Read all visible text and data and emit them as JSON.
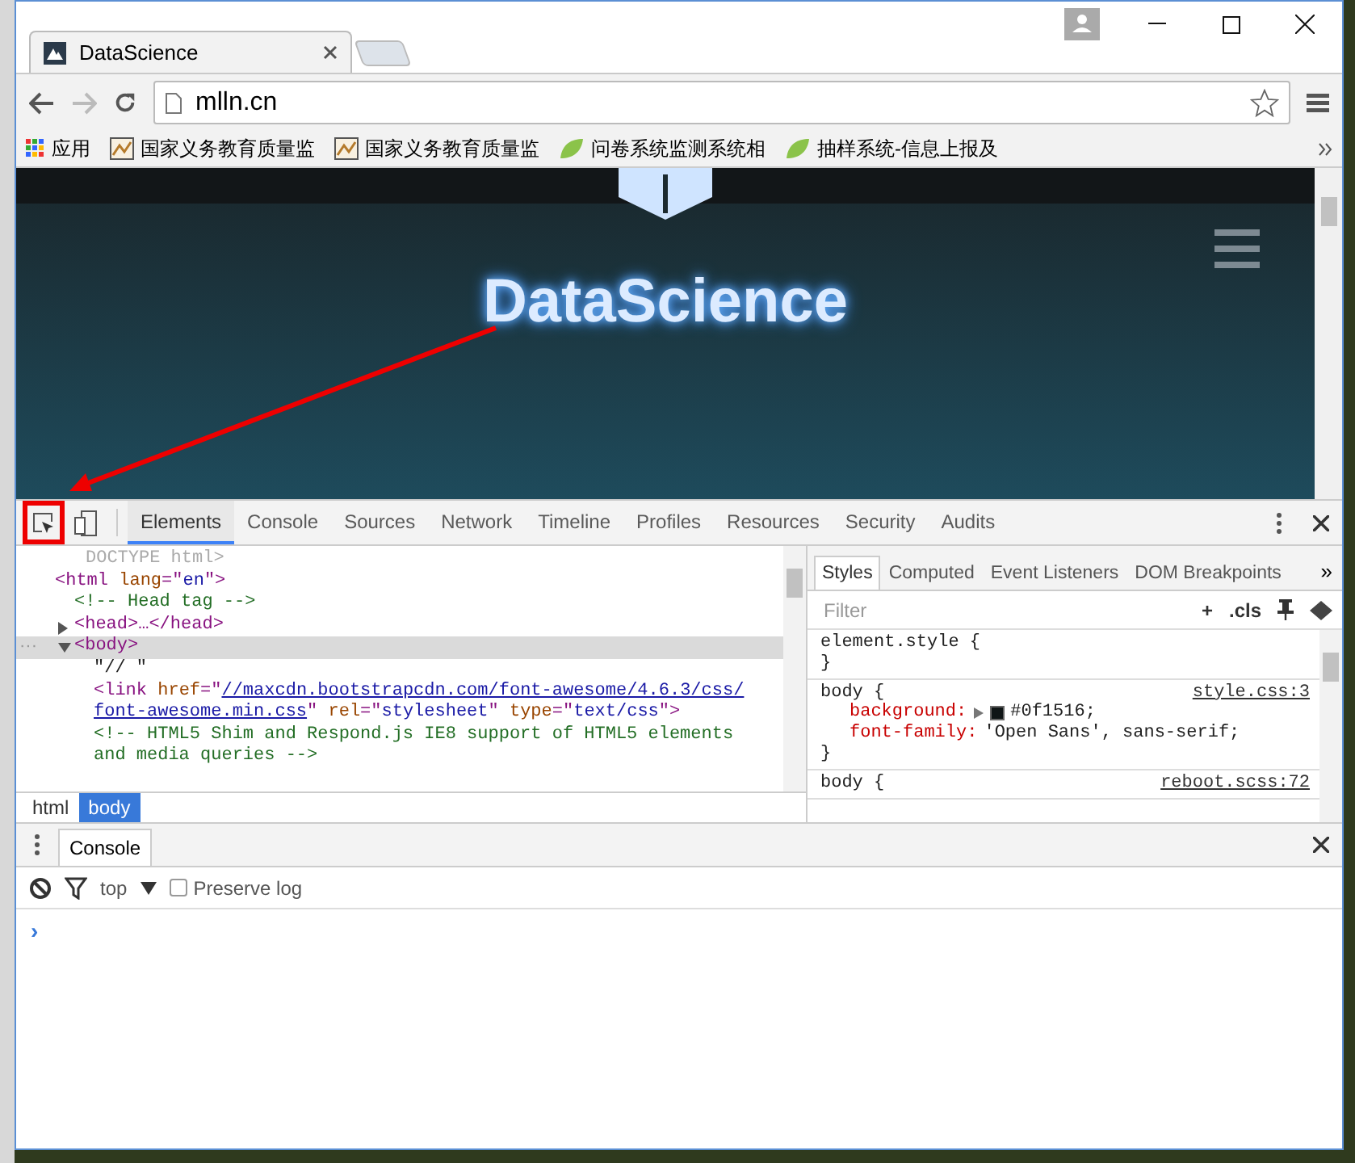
{
  "browser": {
    "tab": {
      "title": "DataScience"
    },
    "address": "mlln.cn",
    "bookmarks": [
      {
        "label": "应用",
        "kind": "apps"
      },
      {
        "label": "国家义务教育质量监",
        "kind": "page"
      },
      {
        "label": "国家义务教育质量监",
        "kind": "page"
      },
      {
        "label": "问卷系统监测系统相",
        "kind": "leaf"
      },
      {
        "label": "抽样系统-信息上报及",
        "kind": "leaf"
      }
    ]
  },
  "page": {
    "brand": "DataScience"
  },
  "devtools": {
    "inspect_highlighted": true,
    "tabs": [
      {
        "label": "Elements",
        "selected": true
      },
      {
        "label": "Console",
        "selected": false
      },
      {
        "label": "Sources",
        "selected": false
      },
      {
        "label": "Network",
        "selected": false
      },
      {
        "label": "Timeline",
        "selected": false
      },
      {
        "label": "Profiles",
        "selected": false
      },
      {
        "label": "Resources",
        "selected": false
      },
      {
        "label": "Security",
        "selected": false
      },
      {
        "label": "Audits",
        "selected": false
      }
    ],
    "selection_marker": "···",
    "dom": [
      {
        "selected": false,
        "lines": [
          [
            {
              "kind": "grey",
              "text": "DOCTYPE html>"
            }
          ]
        ]
      },
      {
        "selected": false,
        "lines": [
          [
            {
              "kind": "tag",
              "text": "<html"
            },
            {
              "kind": "attr",
              "text": " lang"
            },
            {
              "kind": "tag",
              "text": "=\""
            },
            {
              "kind": "value",
              "text": "en"
            },
            {
              "kind": "tag",
              "text": "\">"
            }
          ]
        ],
        "children": [
          {
            "selected": false,
            "lines": [
              [
                {
                  "kind": "comment",
                  "text": "<!-- Head tag -->"
                }
              ]
            ]
          },
          {
            "selected": false,
            "expanded": false,
            "lines": [
              [
                {
                  "kind": "tag",
                  "text": "<head>…</head>"
                }
              ]
            ]
          },
          {
            "selected": true,
            "expanded": true,
            "lines": [
              [
                {
                  "kind": "tag",
                  "text": "<body>"
                }
              ]
            ],
            "children": [
              {
                "selected": false,
                "lines": [
                  [
                    {
                      "kind": "text",
                      "text": "\"// \""
                    }
                  ]
                ]
              },
              {
                "selected": false,
                "lines": [
                  [
                    {
                      "kind": "tag",
                      "text": "<link"
                    },
                    {
                      "kind": "attr",
                      "text": " href"
                    },
                    {
                      "kind": "tag",
                      "text": "=\""
                    },
                    {
                      "kind": "link",
                      "text": "//maxcdn.bootstrapcdn.com/font-awesome/4.6.3/css/"
                    }
                  ],
                  [
                    {
                      "kind": "link",
                      "text": "font-awesome.min.css"
                    },
                    {
                      "kind": "tag",
                      "text": "\""
                    },
                    {
                      "kind": "attr",
                      "text": " rel"
                    },
                    {
                      "kind": "tag",
                      "text": "=\""
                    },
                    {
                      "kind": "value",
                      "text": "stylesheet"
                    },
                    {
                      "kind": "tag",
                      "text": "\""
                    },
                    {
                      "kind": "attr",
                      "text": " type"
                    },
                    {
                      "kind": "tag",
                      "text": "=\""
                    },
                    {
                      "kind": "value",
                      "text": "text/css"
                    },
                    {
                      "kind": "tag",
                      "text": "\">"
                    }
                  ]
                ]
              },
              {
                "selected": false,
                "lines": [
                  [
                    {
                      "kind": "comment",
                      "text": "<!-- HTML5 Shim and Respond.js IE8 support of HTML5 elements"
                    }
                  ],
                  [
                    {
                      "kind": "comment",
                      "text": "and media queries -->"
                    }
                  ]
                ]
              }
            ]
          }
        ]
      }
    ],
    "breadcrumbs": [
      {
        "label": "html",
        "selected": false
      },
      {
        "label": "body",
        "selected": true
      }
    ],
    "side_tabs": [
      {
        "label": "Styles",
        "selected": true
      },
      {
        "label": "Computed",
        "selected": false
      },
      {
        "label": "Event Listeners",
        "selected": false
      },
      {
        "label": "DOM Breakpoints",
        "selected": false
      }
    ],
    "side_more": "»",
    "filter": {
      "placeholder": "Filter"
    },
    "cls": ".cls",
    "add": "+",
    "rules": [
      {
        "selector": "element.style {",
        "close": "}"
      },
      {
        "selector": "body {",
        "source": "style.css:3",
        "props": [
          {
            "name": "background:",
            "value": "#0f1516;",
            "kind": "color"
          },
          {
            "name": "font-family:",
            "value": "'Open Sans', sans-serif;",
            "kind": "plain"
          }
        ],
        "close": "}"
      },
      {
        "selector": "body {",
        "source": "reboot.scss:72"
      }
    ]
  },
  "drawer": {
    "tab": "Console",
    "context": "top",
    "preserve_log": {
      "label": "Preserve log",
      "checked": false
    },
    "prompt": "›"
  }
}
